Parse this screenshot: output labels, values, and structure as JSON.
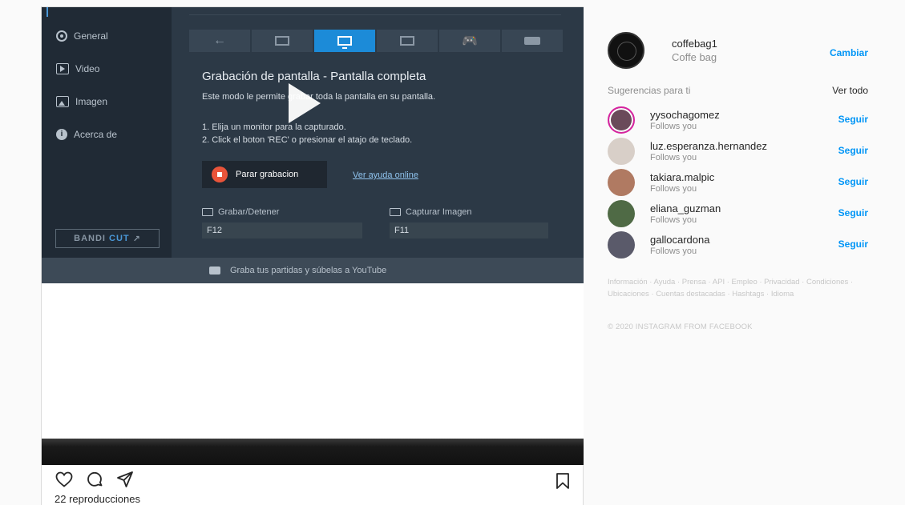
{
  "bandicam": {
    "sidebar": [
      {
        "label": "General",
        "icon": "gear-icon"
      },
      {
        "label": "Video",
        "icon": "video-icon"
      },
      {
        "label": "Imagen",
        "icon": "image-icon"
      },
      {
        "label": "Acerca de",
        "icon": "info-icon"
      }
    ],
    "bandicut_prefix": "BANDI",
    "bandicut_suffix": "CUT",
    "bandicut_arrow": "↗",
    "back_arrow": "←",
    "title": "Grabación de pantalla - Pantalla completa",
    "description": "Este modo le permite grabar toda la pantalla en su pantalla.",
    "step1": "1. Elija un monitor para la capturado.",
    "step2": "2. Click el boton 'REC' o presionar el atajo de teclado.",
    "stop_button": "Parar grabacion",
    "help_link": "Ver ayuda online",
    "hotkey_record_label": "Grabar/Detener",
    "hotkey_record_value": "F12",
    "hotkey_capture_label": "Capturar Imagen",
    "hotkey_capture_value": "F11",
    "footer": "Graba tus partidas y súbelas a YouTube",
    "accent_color": "#1c8bd8"
  },
  "post": {
    "views": "22 reproducciones"
  },
  "sidebar": {
    "account": {
      "username": "coffebag1",
      "full_name": "Coffe bag",
      "switch_label": "Cambiar"
    },
    "suggestions_title": "Sugerencias para ti",
    "see_all": "Ver todo",
    "suggestions": [
      {
        "username": "yysochagomez",
        "subtitle": "Follows you",
        "action": "Seguir"
      },
      {
        "username": "luz.esperanza.hernandez",
        "subtitle": "Follows you",
        "action": "Seguir"
      },
      {
        "username": "takiara.malpic",
        "subtitle": "Follows you",
        "action": "Seguir"
      },
      {
        "username": "eliana_guzman",
        "subtitle": "Follows you",
        "action": "Seguir"
      },
      {
        "username": "gallocardona",
        "subtitle": "Follows you",
        "action": "Seguir"
      }
    ],
    "footer_links": "Información · Ayuda · Prensa · API · Empleo · Privacidad · Condiciones · Ubicaciones · Cuentas destacadas · Hashtags · Idioma",
    "copyright": "© 2020 INSTAGRAM FROM FACEBOOK",
    "link_color": "#0095f6"
  }
}
